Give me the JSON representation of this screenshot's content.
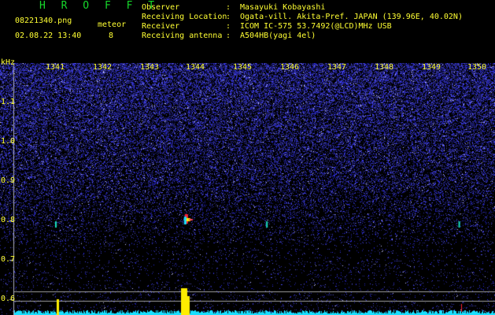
{
  "header": {
    "brand": "H R O F F T",
    "filename": "08221340.png",
    "timestamp": "02.08.22 13:40",
    "meteor_label": "meteor",
    "meteor_count": "8",
    "info": [
      {
        "label": "Observer",
        "value": "Masayuki Kobayashi"
      },
      {
        "label": "Receiving Location",
        "value": "Ogata-vill. Akita-Pref. JAPAN (139.96E, 40.02N)"
      },
      {
        "label": "Receiver",
        "value": "ICOM IC-575 53.7492(@LCD)MHz USB"
      },
      {
        "label": "Receiving antenna",
        "value": "A504HB(yagi 4el)"
      }
    ]
  },
  "spectrogram": {
    "y_unit": "kHz",
    "y_ticks": [
      "1.1",
      "1.0",
      "0.9",
      "0.8",
      "0.7",
      "0.6"
    ],
    "y_values": [
      1.1,
      1.0,
      0.9,
      0.8,
      0.7,
      0.6
    ],
    "x_ticks": [
      "1341",
      "1342",
      "1343",
      "1344",
      "1345",
      "1346",
      "1347",
      "1348",
      "1349",
      "1350"
    ],
    "colors": {
      "background": "#000000",
      "noise": "#3a3ad6",
      "text": "#ffff33",
      "brand": "#16d92b",
      "level": "#19dfff",
      "peak": "#ffee00"
    },
    "meteor_echoes": [
      {
        "time": "1341",
        "freq_khz": 0.79
      },
      {
        "time": "1343.8",
        "freq_khz": 0.8
      },
      {
        "time": "1345.5",
        "freq_khz": 0.79
      },
      {
        "time": "1349.6",
        "freq_khz": 0.79
      }
    ]
  }
}
